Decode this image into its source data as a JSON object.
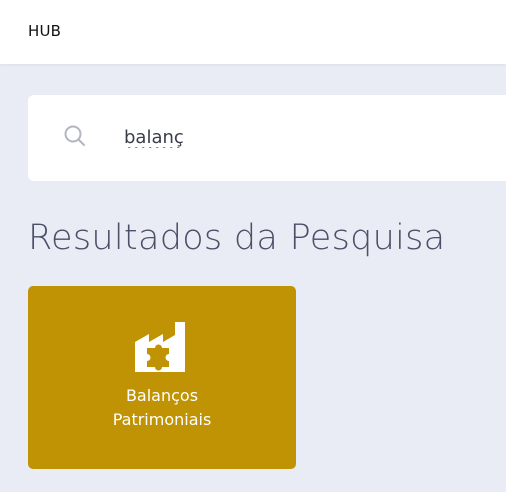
{
  "header": {
    "brand": "HUB"
  },
  "search": {
    "value": "balanç",
    "icon": "search-icon"
  },
  "results": {
    "title": "Resultados da Pesquisa",
    "items": [
      {
        "label": "Balanços\nPatrimoniais",
        "icon": "factory-puzzle-icon",
        "color": "#bf9303"
      }
    ]
  },
  "colors": {
    "background": "#eaecf5",
    "card": "#bf9303",
    "title": "#4a5068"
  }
}
